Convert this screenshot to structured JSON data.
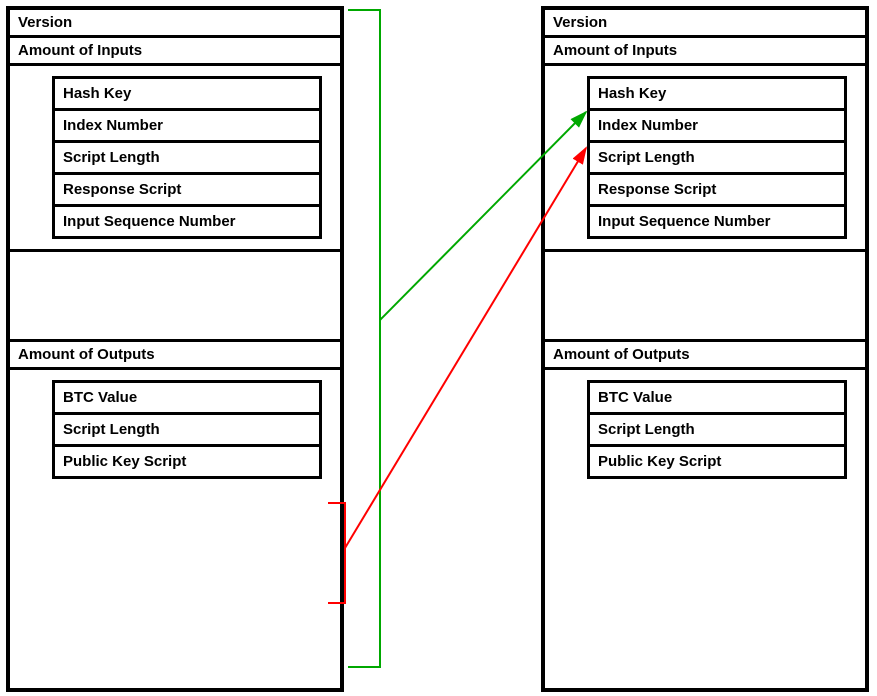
{
  "left": {
    "version": "Version",
    "amountInputs": "Amount of Inputs",
    "input": {
      "hashKey": "Hash Key",
      "indexNumber": "Index Number",
      "scriptLength": "Script Length",
      "responseScript": "Response Script",
      "inputSequenceNumber": "Input Sequence Number"
    },
    "amountOutputs": "Amount of Outputs",
    "output": {
      "btcValue": "BTC Value",
      "scriptLength": "Script Length",
      "publicKeyScript": "Public Key Script"
    }
  },
  "right": {
    "version": "Version",
    "amountInputs": "Amount of Inputs",
    "input": {
      "hashKey": "Hash Key",
      "indexNumber": "Index Number",
      "scriptLength": "Script Length",
      "responseScript": "Response Script",
      "inputSequenceNumber": "Input Sequence Number"
    },
    "amountOutputs": "Amount of Outputs",
    "output": {
      "btcValue": "BTC Value",
      "scriptLength": "Script Length",
      "publicKeyScript": "Public Key Script"
    }
  },
  "arrows": {
    "green": {
      "color": "#00a800",
      "description": "transaction-to-hashkey"
    },
    "red": {
      "color": "#ff0000",
      "description": "output-to-indexnumber"
    }
  }
}
